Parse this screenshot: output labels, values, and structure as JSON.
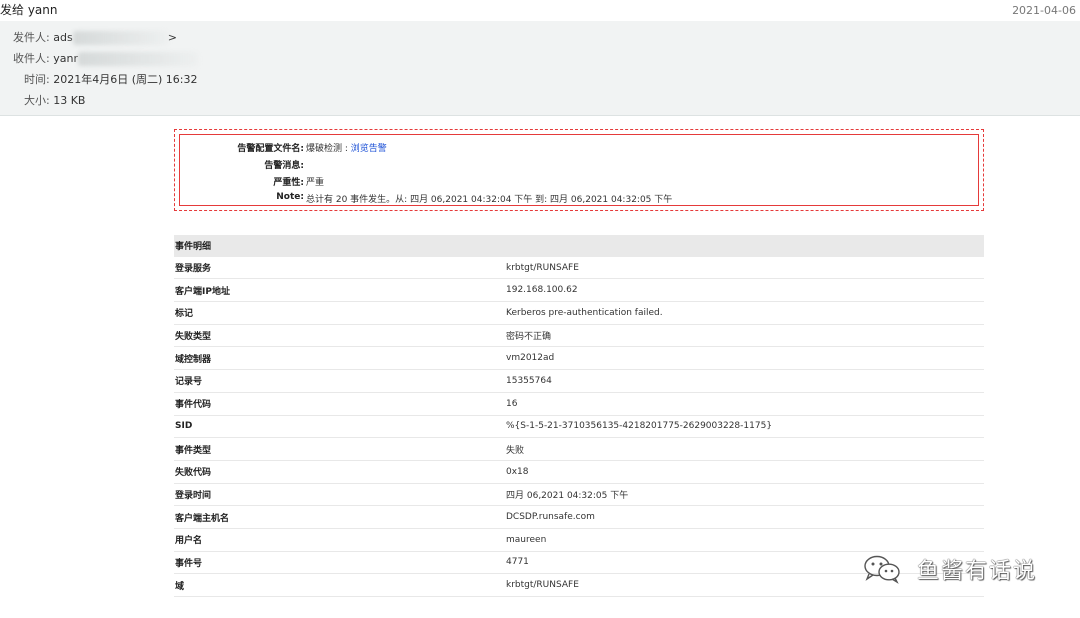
{
  "topbar": {
    "subject": "发给 yann",
    "date": "2021-04-06"
  },
  "header": {
    "from_label": "发件人:",
    "from_value": "ads",
    "from_suffix": ">",
    "to_label": "收件人:",
    "to_value": "yanr",
    "time_label": "时间:",
    "time_value": "2021年4月6日 (周二) 16:32",
    "size_label": "大小:",
    "size_value": "13 KB"
  },
  "alert": {
    "profile_label": "告警配置文件名:",
    "profile_value": "爆破检测 : ",
    "profile_link": "浏览告警",
    "message_label": "告警消息:",
    "message_value": "",
    "severity_label": "严重性:",
    "severity_value": "严重",
    "note_label": "Note:",
    "note_value": "总计有 20 事件发生。从: 四月 06,2021 04:32:04 下午 到: 四月 06,2021 04:32:05 下午"
  },
  "details": {
    "header": "事件明细",
    "rows": [
      {
        "key": "登录服务",
        "value": "krbtgt/RUNSAFE"
      },
      {
        "key": "客户端IP地址",
        "value": "192.168.100.62"
      },
      {
        "key": "标记",
        "value": "Kerberos pre-authentication failed."
      },
      {
        "key": "失败类型",
        "value": "密码不正确"
      },
      {
        "key": "域控制器",
        "value": "vm2012ad"
      },
      {
        "key": "记录号",
        "value": "15355764"
      },
      {
        "key": "事件代码",
        "value": "16"
      },
      {
        "key": "SID",
        "value": "%{S-1-5-21-3710356135-4218201775-2629003228-1175}"
      },
      {
        "key": "事件类型",
        "value": "失败"
      },
      {
        "key": "失败代码",
        "value": "0x18"
      },
      {
        "key": "登录时间",
        "value": "四月 06,2021 04:32:05 下午"
      },
      {
        "key": "客户端主机名",
        "value": "DCSDP.runsafe.com"
      },
      {
        "key": "用户名",
        "value": "maureen"
      },
      {
        "key": "事件号",
        "value": "4771"
      },
      {
        "key": "域",
        "value": "krbtgt/RUNSAFE"
      }
    ]
  },
  "watermark": {
    "text": "鱼酱有话说",
    "icon": "wechat-icon"
  }
}
